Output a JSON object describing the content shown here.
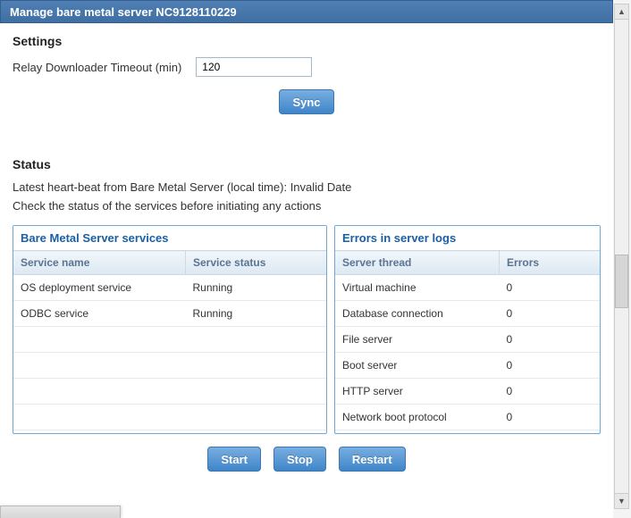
{
  "titlebar": {
    "text": "Manage bare metal server NC9128110229"
  },
  "settings": {
    "heading": "Settings",
    "timeout_label": "Relay Downloader Timeout (min)",
    "timeout_value": "120",
    "sync_label": "Sync"
  },
  "status": {
    "heading": "Status",
    "heartbeat_prefix": "Latest heart-beat from Bare Metal Server (local time):  ",
    "heartbeat_value": "Invalid Date",
    "hint": "Check the status of the services before initiating any actions"
  },
  "services_panel": {
    "title": "Bare Metal Server services",
    "col_name": "Service name",
    "col_status": "Service status",
    "rows": [
      {
        "name": "OS deployment service",
        "status": "Running"
      },
      {
        "name": "ODBC service",
        "status": "Running"
      }
    ]
  },
  "errors_panel": {
    "title": "Errors in server logs",
    "col_thread": "Server thread",
    "col_errors": "Errors",
    "rows": [
      {
        "thread": "Virtual machine",
        "errors": "0"
      },
      {
        "thread": "Database connection",
        "errors": "0"
      },
      {
        "thread": "File server",
        "errors": "0"
      },
      {
        "thread": "Boot server",
        "errors": "0"
      },
      {
        "thread": "HTTP server",
        "errors": "0"
      },
      {
        "thread": "Network boot protocol",
        "errors": "0"
      }
    ]
  },
  "actions": {
    "start": "Start",
    "stop": "Stop",
    "restart": "Restart"
  }
}
